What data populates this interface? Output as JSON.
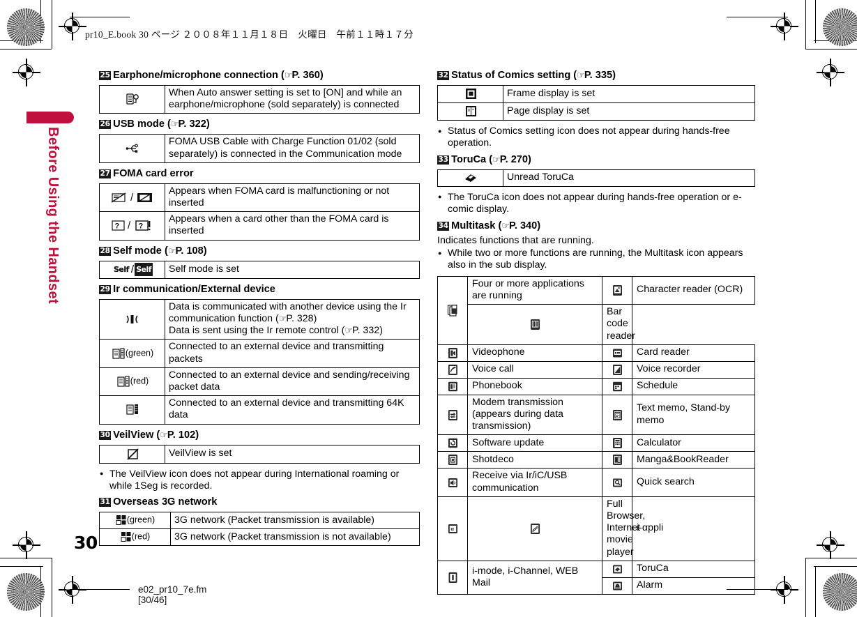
{
  "header": {
    "book_line": "pr10_E.book   30 ページ   ２００８年１１月１８日　火曜日　午前１１時１７分"
  },
  "sidebar": {
    "chapter_title": "Before Using the Handset",
    "accent_color": "#c0113c"
  },
  "page": {
    "number": "30",
    "footer_file": "e02_pr10_7e.fm",
    "footer_range": "[30/46]"
  },
  "left_column": {
    "sections": [
      {
        "num": "25",
        "title": "Earphone/microphone connection",
        "ref": "P. 360",
        "rows": [
          {
            "icon": "earphone-microphone-icon",
            "text": "When Auto answer setting is set to [ON] and while an earphone/microphone (sold separately) is connected"
          }
        ]
      },
      {
        "num": "26",
        "title": "USB mode",
        "ref": "P. 322",
        "rows": [
          {
            "icon": "usb-icon",
            "text": "FOMA USB Cable with Charge Function 01/02 (sold separately) is connected in the Communication mode"
          }
        ]
      },
      {
        "num": "27",
        "title": "FOMA card error",
        "ref": "",
        "rows": [
          {
            "icon": "foma-card-error-icon",
            "text": "Appears when FOMA card is malfunctioning or not inserted"
          },
          {
            "icon": "foreign-card-icon",
            "text": "Appears when a card other than the FOMA card is inserted"
          }
        ]
      },
      {
        "num": "28",
        "title": "Self mode",
        "ref": "P. 108",
        "rows": [
          {
            "icon": "self-mode-icon",
            "label_a": "Self",
            "label_b": "Self",
            "text": "Self mode is set"
          }
        ]
      },
      {
        "num": "29",
        "title": "Ir communication/External device",
        "ref": "",
        "rows": [
          {
            "icon": "ir-communication-icon",
            "text_lines": [
              "Data is communicated with another device using the Ir communication function (",
              "P. 328",
              ")",
              "Data is sent using the Ir remote control (",
              "P. 332",
              ")"
            ]
          },
          {
            "icon": "external-device-green-icon",
            "icon_label": "(green)",
            "text": "Connected to an external device and transmitting packets"
          },
          {
            "icon": "external-device-red-icon",
            "icon_label": "(red)",
            "text": "Connected to an external device and sending/receiving packet data"
          },
          {
            "icon": "external-device-64k-icon",
            "icon_label": "",
            "text": "Connected to an external device and transmitting 64K data"
          }
        ]
      },
      {
        "num": "30",
        "title": "VeilView",
        "ref": "P. 102",
        "rows": [
          {
            "icon": "veilview-icon",
            "text": "VeilView is set"
          }
        ],
        "notes": [
          "The VeilView icon does not appear during International roaming or while 1Seg is recorded."
        ]
      },
      {
        "num": "31",
        "title": "Overseas 3G network",
        "ref": "",
        "rows": [
          {
            "icon": "3g-network-green-icon",
            "icon_label": "(green)",
            "text": "3G network (Packet transmission is available)"
          },
          {
            "icon": "3g-network-red-icon",
            "icon_label": "(red)",
            "text": "3G network (Packet transmission is not available)"
          }
        ]
      }
    ]
  },
  "right_column": {
    "sections": [
      {
        "num": "32",
        "title": "Status of Comics setting",
        "ref": "P. 335",
        "rows": [
          {
            "icon": "frame-display-icon",
            "text": "Frame display is set"
          },
          {
            "icon": "page-display-icon",
            "text": "Page display is set"
          }
        ],
        "notes": [
          "Status of Comics setting icon does not appear during hands-free operation."
        ]
      },
      {
        "num": "33",
        "title": "ToruCa",
        "ref": "P. 270",
        "rows": [
          {
            "icon": "toruca-icon",
            "text": "Unread ToruCa"
          }
        ],
        "notes": [
          "The ToruCa icon does not appear during hands-free operation or e-comic display."
        ]
      },
      {
        "num": "34",
        "title": "Multitask",
        "ref": "P. 340",
        "intro": "Indicates functions that are running.",
        "notes": [
          "While two or more functions are running, the Multitask icon appears also in the sub display."
        ],
        "multitask_rows": [
          {
            "left_icon": "four-or-more-apps-icon",
            "left_text": "Four or more applications are running",
            "right_icon": "character-reader-icon",
            "right_text": "Character reader (OCR)"
          },
          {
            "left_icon": "",
            "left_text": "",
            "right_icon": "bar-code-reader-icon",
            "right_text": "Bar code reader"
          },
          {
            "left_icon": "videophone-icon",
            "left_text": "Videophone",
            "right_icon": "card-reader-icon",
            "right_text": "Card reader"
          },
          {
            "left_icon": "voice-call-icon",
            "left_text": "Voice call",
            "right_icon": "voice-recorder-icon",
            "right_text": "Voice recorder"
          },
          {
            "left_icon": "phonebook-icon",
            "left_text": "Phonebook",
            "right_icon": "schedule-icon",
            "right_text": "Schedule"
          },
          {
            "left_icon": "modem-transmission-icon",
            "left_text": "Modem transmission (appears during data transmission)",
            "right_icon": "text-memo-icon",
            "right_text": "Text memo, Stand-by memo"
          },
          {
            "left_icon": "software-update-icon",
            "left_text": "Software update",
            "right_icon": "calculator-icon",
            "right_text": "Calculator"
          },
          {
            "left_icon": "shotdeco-icon",
            "left_text": "Shotdeco",
            "right_icon": "manga-bookreader-icon",
            "right_text": "Manga&BookReader"
          },
          {
            "left_icon": "receive-ir-ic-usb-icon",
            "left_text": "Receive via Ir/iC/USB communication",
            "right_icon": "quick-search-icon",
            "right_text": "Quick search"
          },
          {
            "left_icon": "i-appli-icon",
            "left_text": "i-αppli",
            "right_icon": "full-browser-icon",
            "right_text": "Full Browser, Internet movie player"
          },
          {
            "left_icon": "i-mode-icon",
            "left_text": "i-mode, i-Channel, WEB Mail",
            "right_icon": "toruca-multitask-icon",
            "right_text": "ToruCa"
          },
          {
            "left_icon": "",
            "left_text": "",
            "right_icon": "alarm-icon",
            "right_text": "Alarm"
          }
        ]
      }
    ]
  }
}
